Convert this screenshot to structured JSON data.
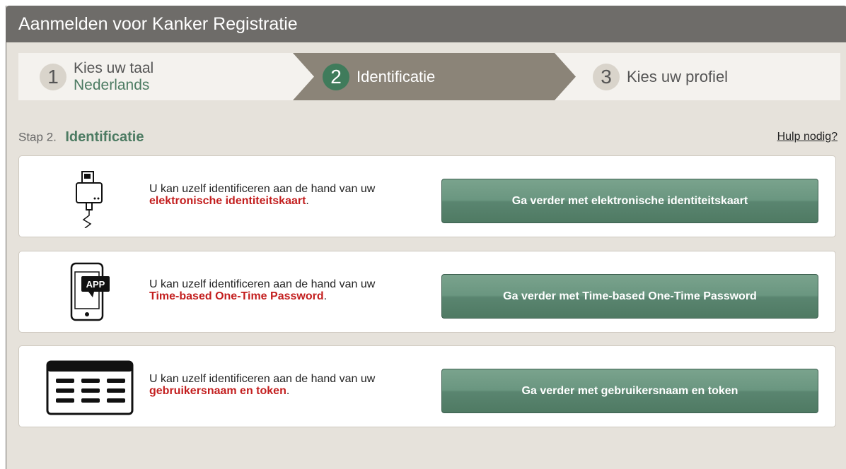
{
  "window": {
    "title": "Aanmelden voor Kanker Registratie"
  },
  "steps": [
    {
      "num": "1",
      "label": "Kies uw taal",
      "sub": "Nederlands"
    },
    {
      "num": "2",
      "label": "Identificatie"
    },
    {
      "num": "3",
      "label": "Kies uw profiel"
    }
  ],
  "heading": {
    "pre": "Stap 2.",
    "main": "Identificatie",
    "help": "Hulp nodig?"
  },
  "options": [
    {
      "icon": "eid-card-reader-icon",
      "text": "U kan uzelf identificeren aan de hand van uw",
      "highlight": "elektronische identiteitskaart",
      "suffix": ".",
      "button": "Ga verder met elektronische identiteitskaart"
    },
    {
      "icon": "phone-app-icon",
      "icon_label": "APP",
      "text": "U kan uzelf identificeren aan de hand van uw",
      "highlight": "Time-based One-Time Password",
      "suffix": ".",
      "button": "Ga verder met Time-based One-Time Password"
    },
    {
      "icon": "token-grid-icon",
      "text": "U kan uzelf identificeren aan de hand van uw",
      "highlight": "gebruikersnaam en token",
      "suffix": ".",
      "button": "Ga verder met gebruikersnaam en token"
    }
  ],
  "colors": {
    "title_bar": "#6e6c69",
    "background": "#e6e2db",
    "accent_green": "#4c7b62",
    "highlight_red": "#c31f1f",
    "active_step": "#8b8478"
  }
}
